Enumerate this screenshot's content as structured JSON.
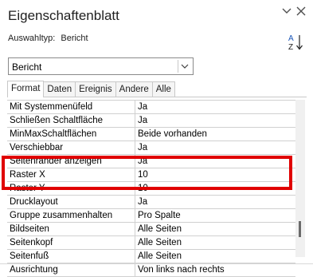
{
  "window": {
    "title": "Eigenschaftenblatt",
    "minimize_glyph": "⌄",
    "close_glyph": "✕"
  },
  "selection": {
    "label": "Auswahltyp:",
    "value": "Bericht"
  },
  "object_dropdown": {
    "value": "Bericht"
  },
  "tabs": [
    {
      "label": "Format",
      "active": true
    },
    {
      "label": "Daten",
      "active": false
    },
    {
      "label": "Ereignis",
      "active": false
    },
    {
      "label": "Andere",
      "active": false
    },
    {
      "label": "Alle",
      "active": false
    }
  ],
  "properties": [
    {
      "name": "Mit Systemmenüfeld",
      "value": "Ja"
    },
    {
      "name": "Schließen Schaltfläche",
      "value": "Ja"
    },
    {
      "name": "MinMaxSchaltflächen",
      "value": "Beide vorhanden"
    },
    {
      "name": "Verschiebbar",
      "value": "Ja"
    },
    {
      "name": "Seitenränder anzeigen",
      "value": "Ja"
    },
    {
      "name": "Raster X",
      "value": "10"
    },
    {
      "name": "Raster Y",
      "value": "10"
    },
    {
      "name": "Drucklayout",
      "value": "Ja"
    },
    {
      "name": "Gruppe zusammenhalten",
      "value": "Pro Spalte"
    },
    {
      "name": "Bildseiten",
      "value": "Alle Seiten"
    },
    {
      "name": "Seitenkopf",
      "value": "Alle Seiten"
    },
    {
      "name": "Seitenfuß",
      "value": "Alle Seiten"
    },
    {
      "name": "Ausrichtung",
      "value": "Von links nach rechts"
    }
  ],
  "colors": {
    "highlight": "#e00000"
  },
  "icons": {
    "sort": "sort-az-icon",
    "dropdown": "chevron-down-icon"
  }
}
